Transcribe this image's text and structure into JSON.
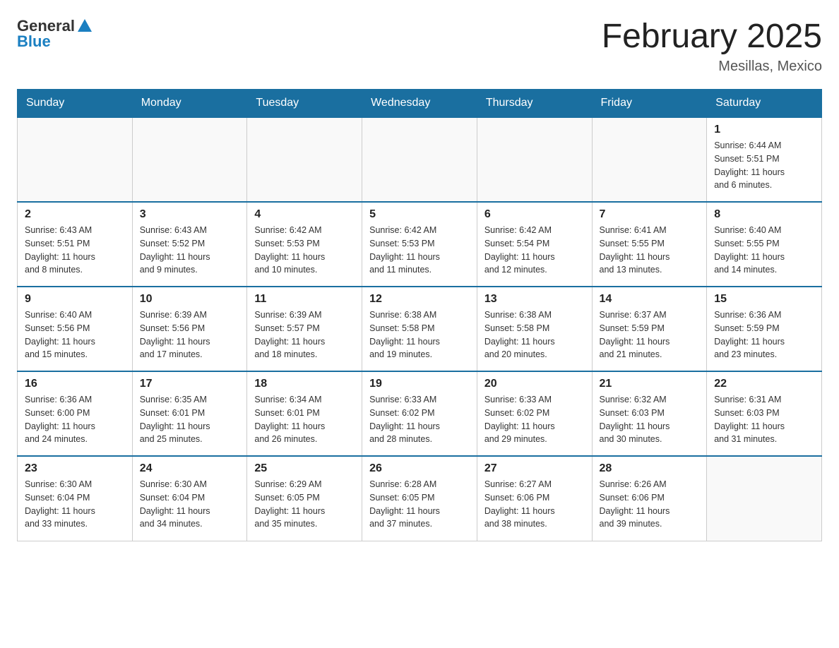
{
  "logo": {
    "general": "General",
    "blue": "Blue"
  },
  "header": {
    "month": "February 2025",
    "location": "Mesillas, Mexico"
  },
  "weekdays": [
    "Sunday",
    "Monday",
    "Tuesday",
    "Wednesday",
    "Thursday",
    "Friday",
    "Saturday"
  ],
  "weeks": [
    [
      {
        "day": "",
        "info": ""
      },
      {
        "day": "",
        "info": ""
      },
      {
        "day": "",
        "info": ""
      },
      {
        "day": "",
        "info": ""
      },
      {
        "day": "",
        "info": ""
      },
      {
        "day": "",
        "info": ""
      },
      {
        "day": "1",
        "info": "Sunrise: 6:44 AM\nSunset: 5:51 PM\nDaylight: 11 hours\nand 6 minutes."
      }
    ],
    [
      {
        "day": "2",
        "info": "Sunrise: 6:43 AM\nSunset: 5:51 PM\nDaylight: 11 hours\nand 8 minutes."
      },
      {
        "day": "3",
        "info": "Sunrise: 6:43 AM\nSunset: 5:52 PM\nDaylight: 11 hours\nand 9 minutes."
      },
      {
        "day": "4",
        "info": "Sunrise: 6:42 AM\nSunset: 5:53 PM\nDaylight: 11 hours\nand 10 minutes."
      },
      {
        "day": "5",
        "info": "Sunrise: 6:42 AM\nSunset: 5:53 PM\nDaylight: 11 hours\nand 11 minutes."
      },
      {
        "day": "6",
        "info": "Sunrise: 6:42 AM\nSunset: 5:54 PM\nDaylight: 11 hours\nand 12 minutes."
      },
      {
        "day": "7",
        "info": "Sunrise: 6:41 AM\nSunset: 5:55 PM\nDaylight: 11 hours\nand 13 minutes."
      },
      {
        "day": "8",
        "info": "Sunrise: 6:40 AM\nSunset: 5:55 PM\nDaylight: 11 hours\nand 14 minutes."
      }
    ],
    [
      {
        "day": "9",
        "info": "Sunrise: 6:40 AM\nSunset: 5:56 PM\nDaylight: 11 hours\nand 15 minutes."
      },
      {
        "day": "10",
        "info": "Sunrise: 6:39 AM\nSunset: 5:56 PM\nDaylight: 11 hours\nand 17 minutes."
      },
      {
        "day": "11",
        "info": "Sunrise: 6:39 AM\nSunset: 5:57 PM\nDaylight: 11 hours\nand 18 minutes."
      },
      {
        "day": "12",
        "info": "Sunrise: 6:38 AM\nSunset: 5:58 PM\nDaylight: 11 hours\nand 19 minutes."
      },
      {
        "day": "13",
        "info": "Sunrise: 6:38 AM\nSunset: 5:58 PM\nDaylight: 11 hours\nand 20 minutes."
      },
      {
        "day": "14",
        "info": "Sunrise: 6:37 AM\nSunset: 5:59 PM\nDaylight: 11 hours\nand 21 minutes."
      },
      {
        "day": "15",
        "info": "Sunrise: 6:36 AM\nSunset: 5:59 PM\nDaylight: 11 hours\nand 23 minutes."
      }
    ],
    [
      {
        "day": "16",
        "info": "Sunrise: 6:36 AM\nSunset: 6:00 PM\nDaylight: 11 hours\nand 24 minutes."
      },
      {
        "day": "17",
        "info": "Sunrise: 6:35 AM\nSunset: 6:01 PM\nDaylight: 11 hours\nand 25 minutes."
      },
      {
        "day": "18",
        "info": "Sunrise: 6:34 AM\nSunset: 6:01 PM\nDaylight: 11 hours\nand 26 minutes."
      },
      {
        "day": "19",
        "info": "Sunrise: 6:33 AM\nSunset: 6:02 PM\nDaylight: 11 hours\nand 28 minutes."
      },
      {
        "day": "20",
        "info": "Sunrise: 6:33 AM\nSunset: 6:02 PM\nDaylight: 11 hours\nand 29 minutes."
      },
      {
        "day": "21",
        "info": "Sunrise: 6:32 AM\nSunset: 6:03 PM\nDaylight: 11 hours\nand 30 minutes."
      },
      {
        "day": "22",
        "info": "Sunrise: 6:31 AM\nSunset: 6:03 PM\nDaylight: 11 hours\nand 31 minutes."
      }
    ],
    [
      {
        "day": "23",
        "info": "Sunrise: 6:30 AM\nSunset: 6:04 PM\nDaylight: 11 hours\nand 33 minutes."
      },
      {
        "day": "24",
        "info": "Sunrise: 6:30 AM\nSunset: 6:04 PM\nDaylight: 11 hours\nand 34 minutes."
      },
      {
        "day": "25",
        "info": "Sunrise: 6:29 AM\nSunset: 6:05 PM\nDaylight: 11 hours\nand 35 minutes."
      },
      {
        "day": "26",
        "info": "Sunrise: 6:28 AM\nSunset: 6:05 PM\nDaylight: 11 hours\nand 37 minutes."
      },
      {
        "day": "27",
        "info": "Sunrise: 6:27 AM\nSunset: 6:06 PM\nDaylight: 11 hours\nand 38 minutes."
      },
      {
        "day": "28",
        "info": "Sunrise: 6:26 AM\nSunset: 6:06 PM\nDaylight: 11 hours\nand 39 minutes."
      },
      {
        "day": "",
        "info": ""
      }
    ]
  ]
}
